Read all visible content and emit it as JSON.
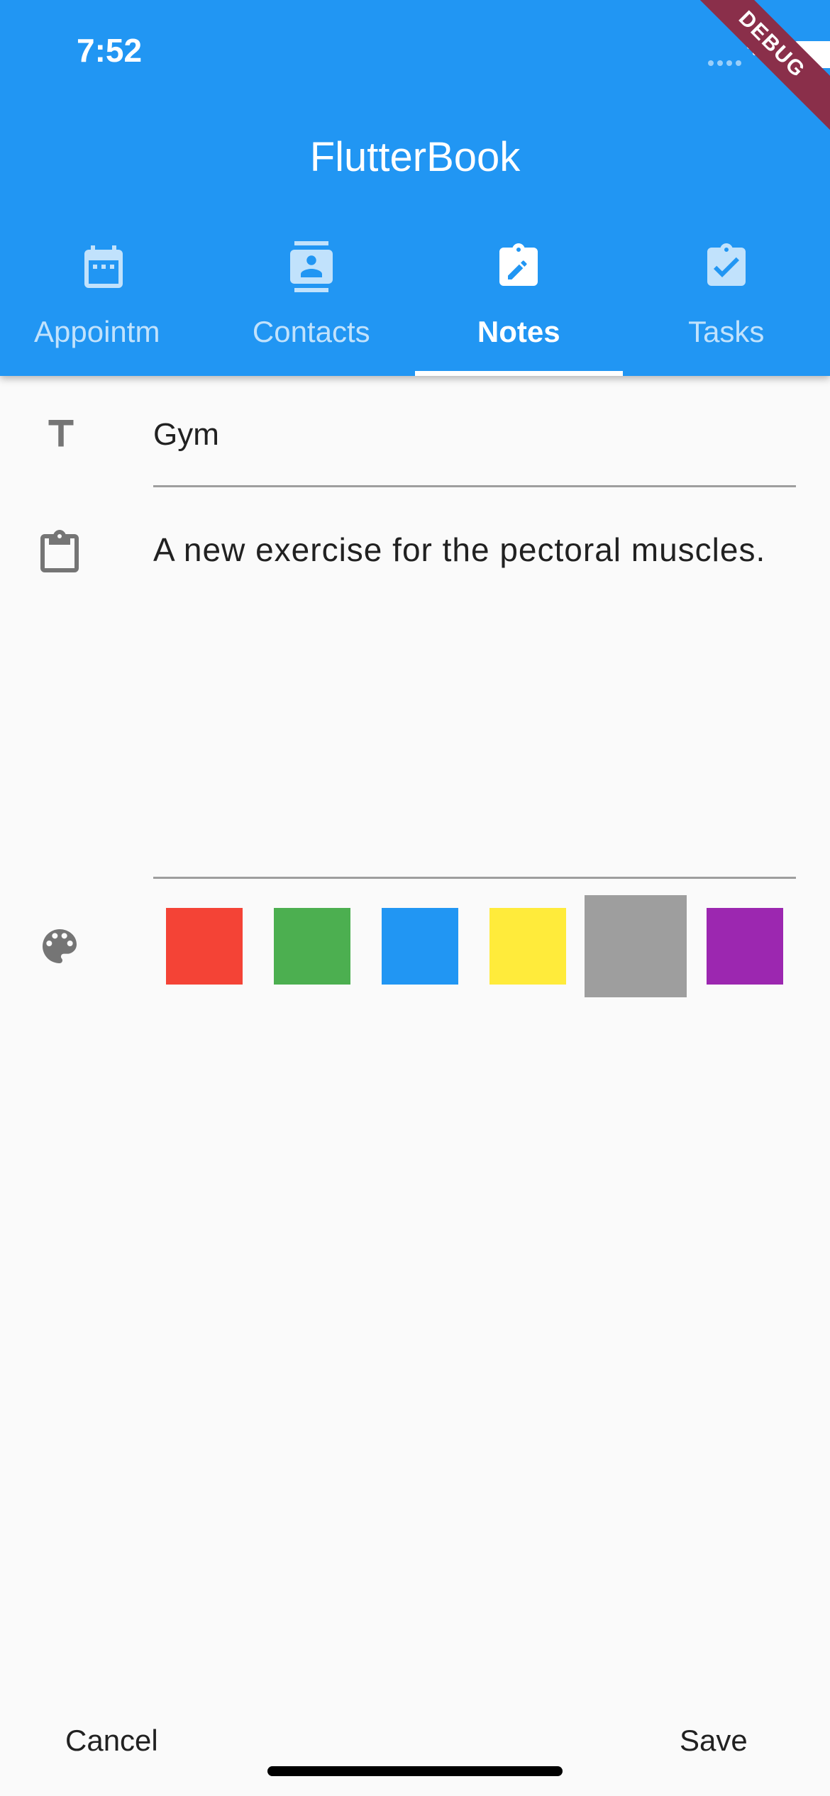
{
  "status_bar": {
    "time": "7:52",
    "debug_label": "DEBUG"
  },
  "app": {
    "title": "FlutterBook"
  },
  "tabs": [
    {
      "label": "Appointm",
      "icon": "calendar-icon",
      "active": false
    },
    {
      "label": "Contacts",
      "icon": "contact-card-icon",
      "active": false
    },
    {
      "label": "Notes",
      "icon": "note-edit-icon",
      "active": true
    },
    {
      "label": "Tasks",
      "icon": "clipboard-check-icon",
      "active": false
    }
  ],
  "note": {
    "title": "Gym",
    "content": "A new exercise for the pectoral muscles.",
    "title_icon": "title-icon",
    "content_icon": "clipboard-icon",
    "color_icon": "palette-icon"
  },
  "colors": [
    {
      "name": "red",
      "hex": "#f44336",
      "selected": false
    },
    {
      "name": "green",
      "hex": "#4caf50",
      "selected": false
    },
    {
      "name": "blue",
      "hex": "#2196f3",
      "selected": false
    },
    {
      "name": "yellow",
      "hex": "#ffeb3b",
      "selected": false
    },
    {
      "name": "grey",
      "hex": "#9e9e9e",
      "selected": true
    },
    {
      "name": "purple",
      "hex": "#9c27b0",
      "selected": false
    }
  ],
  "actions": {
    "cancel": "Cancel",
    "save": "Save"
  }
}
